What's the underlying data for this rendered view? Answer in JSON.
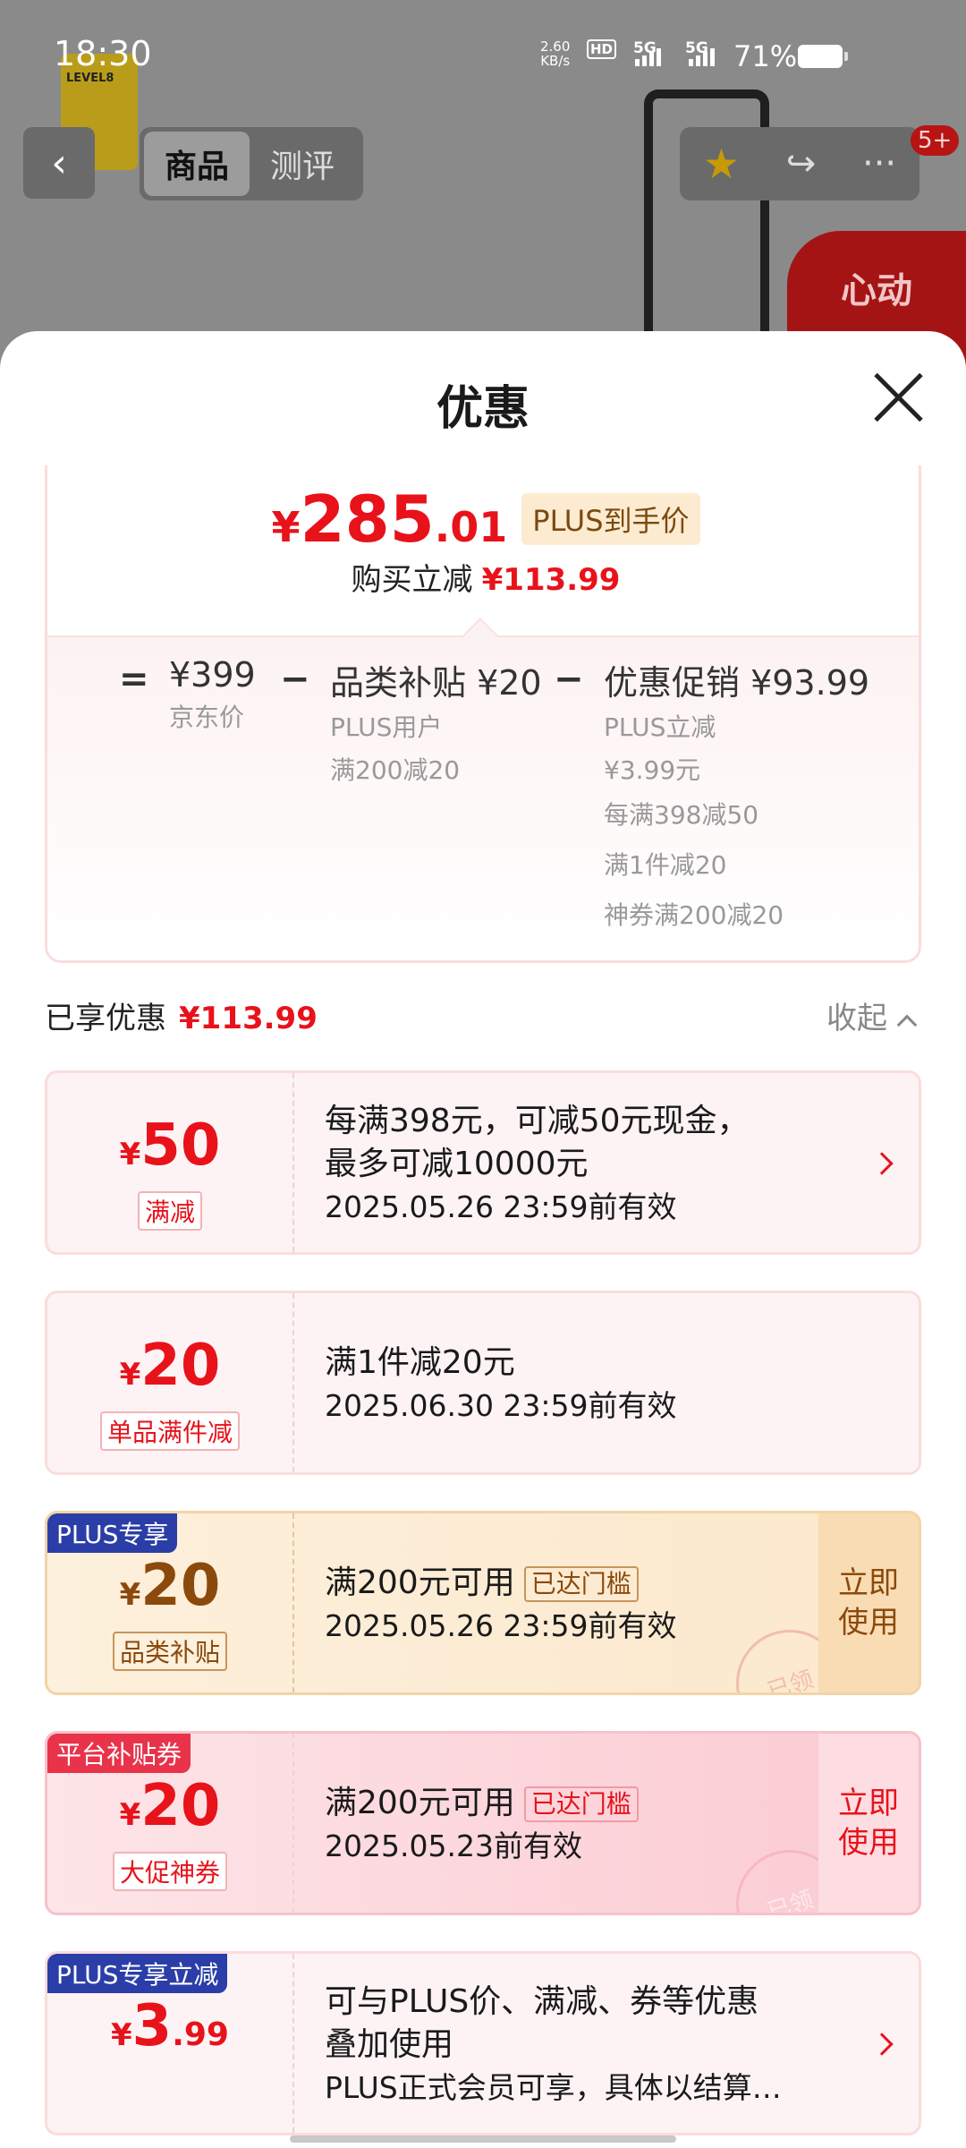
{
  "status_bar": {
    "time": "18:30",
    "net_speed_value": "2.60",
    "net_speed_unit": "KB/s",
    "hd": "HD",
    "sim1": "5G",
    "sim2": "5G",
    "battery": "71%"
  },
  "background": {
    "logo_text": "LEVEL8",
    "tabs": [
      "商品",
      "测评"
    ],
    "active_tab": "商品",
    "badge": "5+",
    "red_banner_text": "心动"
  },
  "sheet": {
    "title": "优惠",
    "summary": {
      "price_symbol": "¥",
      "price_int": "285",
      "price_dec": ".01",
      "plus_tag": "PLUS到手价",
      "reduce_label": "购买立减",
      "reduce_amount": "¥113.99",
      "equals": "=",
      "minus": "−",
      "jd_price": "¥399",
      "jd_price_label": "京东价",
      "subsidy": "品类补贴 ¥20",
      "subsidy_sub1": "PLUS用户",
      "subsidy_sub2": "满200减20",
      "promo": "优惠促销 ¥93.99",
      "promo_items": [
        "PLUS立减",
        "¥3.99元",
        "每满398减50",
        "满1件减20",
        "神券满200减20"
      ]
    },
    "enjoyed_label": "已享优惠",
    "enjoyed_amount": "¥113.99",
    "collapse_label": "收起",
    "coupons": [
      {
        "symbol": "¥",
        "amount": "50",
        "decimal": "",
        "tag": "满减",
        "line1": "每满398元，可减50元现金，",
        "line2": "最多可减10000元",
        "date": "2025.05.26 23:59前有效"
      },
      {
        "symbol": "¥",
        "amount": "20",
        "decimal": "",
        "tag": "单品满件减",
        "line1": "满1件减20元",
        "date": "2025.06.30 23:59前有效"
      },
      {
        "corner": "PLUS专享",
        "symbol": "¥",
        "amount": "20",
        "decimal": "",
        "tag": "品类补贴",
        "line1": "满200元可用",
        "threshold": "已达门槛",
        "date": "2025.05.26 23:59前有效",
        "use_line1": "立即",
        "use_line2": "使用",
        "stamp": "已领"
      },
      {
        "corner": "平台补贴券",
        "symbol": "¥",
        "amount": "20",
        "decimal": "",
        "tag": "大促神券",
        "line1": "满200元可用",
        "threshold": "已达门槛",
        "date": "2025.05.23前有效",
        "use_line1": "立即",
        "use_line2": "使用",
        "stamp": "已领"
      },
      {
        "corner": "PLUS专享立减",
        "symbol": "¥",
        "amount": "3",
        "decimal": ".99",
        "line1": "可与PLUS价、满减、券等优惠",
        "line2": "叠加使用",
        "date": "PLUS正式会员可享，具体以结算…"
      }
    ]
  },
  "colors": {
    "accent_red": "#e8121b",
    "gold_text": "#8b4a0c",
    "corner_blue": "#2b3ea8",
    "corner_red": "#e8334a"
  }
}
